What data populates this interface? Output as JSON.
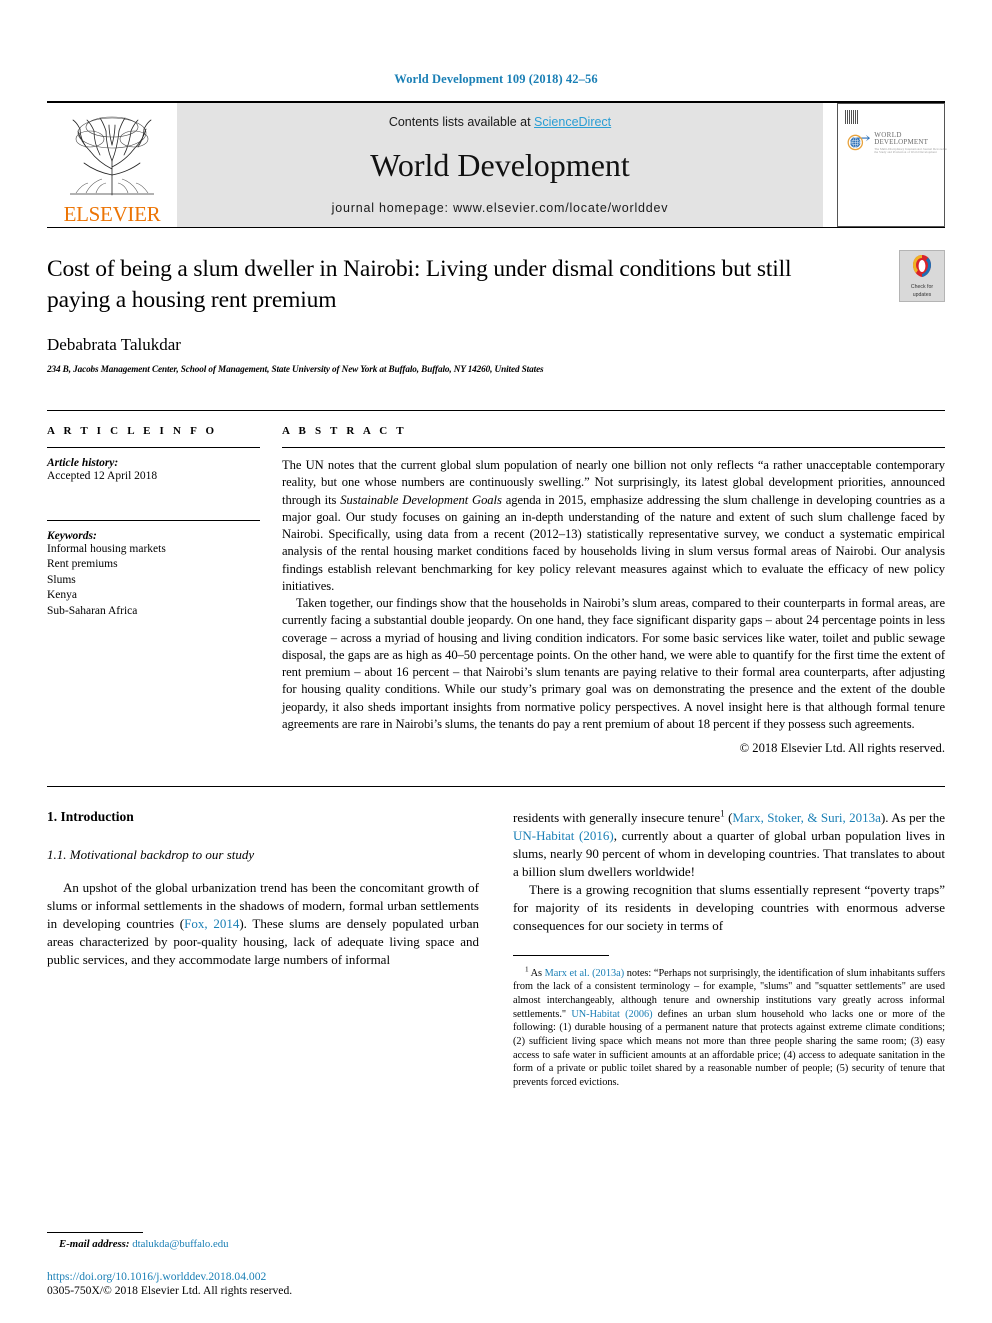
{
  "running_head": "World Development 109 (2018) 42–56",
  "masthead": {
    "publisher_name": "ELSEVIER",
    "contents_prefix": "Contents lists available at ",
    "sciencedirect": "ScienceDirect",
    "journal_name": "World Development",
    "homepage": "journal homepage: www.elsevier.com/locate/worlddev",
    "cover": {
      "line1": "WORLD",
      "line2": "DEVELOPMENT",
      "line3": "The Multi-Disciplinary International Journal Devoted to the Study and Promotion of World Development"
    }
  },
  "title_block": {
    "title": "Cost of being a slum dweller in Nairobi: Living under dismal conditions but still paying a housing rent premium",
    "crossmark_line1": "Check for",
    "crossmark_line2": "updates",
    "authors": "Debabrata Talukdar",
    "affiliation": "234 B, Jacobs Management Center, School of Management, State University of New York at Buffalo, Buffalo, NY 14260, United States"
  },
  "article_info": {
    "heading": "A R T I C L E   I N F O",
    "history_label": "Article history:",
    "history_value": "Accepted 12 April 2018",
    "keywords_label": "Keywords:",
    "keywords": [
      "Informal housing markets",
      "Rent premiums",
      "Slums",
      "Kenya",
      "Sub-Saharan Africa"
    ]
  },
  "abstract": {
    "heading": "A B S T R A C T",
    "p1_a": "The UN notes that the current global slum population of nearly one billion not only reflects “a rather unacceptable contemporary reality, but one whose numbers are continuously swelling.” Not surprisingly, its latest global development priorities, announced through its ",
    "p1_italic": "Sustainable Development Goals",
    "p1_b": " agenda in 2015, emphasize addressing the slum challenge in developing countries as a major goal. Our study focuses on gaining an in-depth understanding of the nature and extent of such slum challenge faced by Nairobi. Specifically, using data from a recent (2012–13) statistically representative survey, we conduct a systematic empirical analysis of the rental housing market conditions faced by households living in slum versus formal areas of Nairobi. Our analysis findings establish relevant benchmarking for key policy relevant measures against which to evaluate the efficacy of new policy initiatives.",
    "p2": "Taken together, our findings show that the households in Nairobi’s slum areas, compared to their counterparts in formal areas, are currently facing a substantial double jeopardy. On one hand, they face significant disparity gaps – about 24 percentage points in less coverage – across a myriad of housing and living condition indicators. For some basic services like water, toilet and public sewage disposal, the gaps are as high as 40–50 percentage points. On the other hand, we were able to quantify for the first time the extent of rent premium – about 16 percent – that Nairobi’s slum tenants are paying relative to their formal area counterparts, after adjusting for housing quality conditions. While our study’s primary goal was on demonstrating the presence and the extent of the double jeopardy, it also sheds important insights from normative policy perspectives. A novel insight here is that although formal tenure agreements are rare in Nairobi’s slums, the tenants do pay a rent premium of about 18 percent if they possess such agreements.",
    "copyright": "© 2018 Elsevier Ltd. All rights reserved."
  },
  "body": {
    "section_heading": "1. Introduction",
    "subsection_heading": "1.1. Motivational backdrop to our study",
    "left_p1_a": "An upshot of the global urbanization trend has been the concomitant growth of slums or informal settlements in the shadows of modern, formal urban settlements in developing countries (",
    "left_p1_ref": "Fox, 2014",
    "left_p1_b": "). These slums are densely populated urban areas characterized by poor-quality housing, lack of adequate living space and public services, and they accommodate large numbers of informal",
    "right_p1_a": "residents with generally insecure tenure",
    "right_p1_sup": "1",
    "right_p1_b": " (",
    "right_p1_ref1": "Marx, Stoker, & Suri, 2013a",
    "right_p1_c": "). As per the ",
    "right_p1_ref2": "UN-Habitat (2016)",
    "right_p1_d": ", currently about a quarter of global urban population lives in slums, nearly 90 percent of whom in developing countries. That translates to about a billion slum dwellers worldwide!",
    "right_p2": "There is a growing recognition that slums essentially represent “poverty traps” for majority of its residents in developing countries with enormous adverse consequences for our society in terms of"
  },
  "footnote": {
    "marker": "1",
    "a": " As ",
    "ref1": "Marx et al. (2013a)",
    "b": " notes: “Perhaps not surprisingly, the identification of slum inhabitants suffers from the lack of a consistent terminology – for example, \"slums\" and \"squatter settlements\" are used almost interchangeably, although tenure and ownership institutions vary greatly across informal settlements.\" ",
    "ref2": "UN-Habitat (2006)",
    "c": " defines an urban slum household who lacks one or more of the following: (1) durable housing of a permanent nature that protects against extreme climate conditions; (2) sufficient living space which means not more than three people sharing the same room; (3) easy access to safe water in sufficient amounts at an affordable price; (4) access to adequate sanitation in the form of a private or public toilet shared by a reasonable number of people; (5) security of tenure that prevents forced evictions."
  },
  "page_footer": {
    "email_label": "E-mail address:",
    "email": "dtalukda@buffalo.edu",
    "doi": "https://doi.org/10.1016/j.worlddev.2018.04.002",
    "issn": "0305-750X/© 2018 Elsevier Ltd. All rights reserved."
  },
  "colors": {
    "link": "#1a7fb5",
    "sciencedirect": "#2a9ed4",
    "elsevier_orange": "#ec7404",
    "masthead_bg": "#e3e3e3"
  }
}
